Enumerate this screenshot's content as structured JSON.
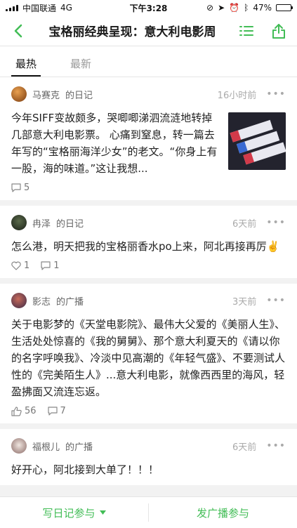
{
  "status_bar": {
    "carrier": "中国联通",
    "network": "4G",
    "time": "下午3:28",
    "battery": "47%",
    "battery_level": 0.47
  },
  "navbar": {
    "title": "宝格丽经典呈现：意大利电影周"
  },
  "tabs": [
    {
      "label": "最热"
    },
    {
      "label": "最新"
    }
  ],
  "posts": [
    {
      "author": "马赛克",
      "type": "的日记",
      "time": "16小时前",
      "text": "今年SIFF变故颇多，哭唧唧涕泗流涟地转掉几部意大利电影票。 心痛到窒息，转一篇去年写的“宝格丽海洋少女”的老文。“你身上有一股，海的味道。”这让我想...",
      "comments": "5"
    },
    {
      "author": "冉泽",
      "type": "的日记",
      "time": "6天前",
      "text": "怎么港，明天把我的宝格丽香水po上来，阿北再接再厉✌️",
      "likes": "1",
      "comments": "1"
    },
    {
      "author": "影志",
      "type": "的广播",
      "time": "3天前",
      "text": "关于电影梦的《天堂电影院》、最伟大父爱的《美丽人生》、生活处处惊喜的《我的舅舅》、那个意大利夏天的《请以你的名字呼唤我》、冷淡中见高潮的《年轻气盛》、不要测试人性的《完美陌生人》...意大利电影，就像西西里的海风，轻盈拂面又流连忘返。",
      "likes": "56",
      "comments": "7"
    },
    {
      "author": "福根儿",
      "type": "的广播",
      "time": "6天前",
      "text": "好开心，阿北接到大单了！！！"
    }
  ],
  "bottom_bar": {
    "write_diary": "写日记参与",
    "post_broadcast": "发广播参与"
  },
  "colors": {
    "accent": "#42bd56"
  }
}
